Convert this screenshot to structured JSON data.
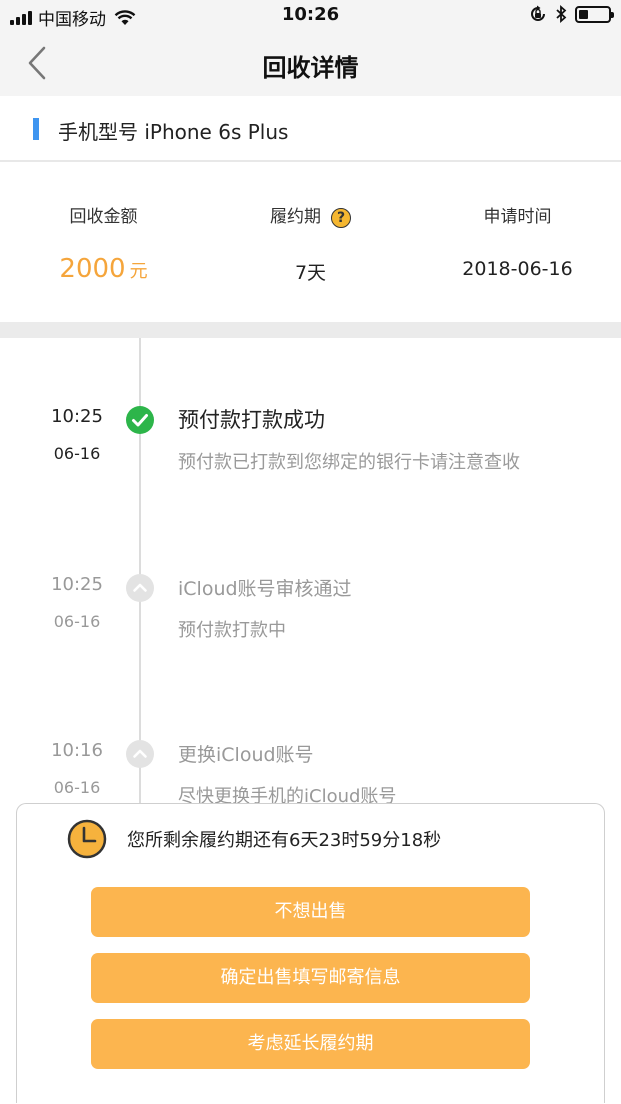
{
  "status_bar": {
    "carrier": "中国移动",
    "time": "10:26"
  },
  "header": {
    "title": "回收详情"
  },
  "model": {
    "label": "手机型号 iPhone 6s Plus"
  },
  "summary": {
    "amount_label": "回收金额",
    "amount_value": "2000",
    "amount_unit": "元",
    "period_label": "履约期",
    "period_value": "7天",
    "apply_label": "申请时间",
    "apply_value": "2018-06-16"
  },
  "timeline": [
    {
      "time": "10:25",
      "date": "06-16",
      "title": "预付款打款成功",
      "desc": "预付款已打款到您绑定的银行卡请注意查收",
      "state": "done"
    },
    {
      "time": "10:25",
      "date": "06-16",
      "title": "iCloud账号审核通过",
      "desc": "预付款打款中",
      "state": "past"
    },
    {
      "time": "10:16",
      "date": "06-16",
      "title": "更换iCloud账号",
      "desc": "尽快更换手机的iCloud账号",
      "state": "past"
    }
  ],
  "panel": {
    "remaining_text": "您所剩余履约期还有6天23时59分18秒",
    "buttons": [
      "不想出售",
      "确定出售填写邮寄信息",
      "考虑延长履约期"
    ]
  },
  "colors": {
    "accent_orange": "#f5a53b",
    "button_orange": "#fcb54f",
    "success_green": "#2db54a",
    "model_bar_blue": "#3e95f0"
  }
}
